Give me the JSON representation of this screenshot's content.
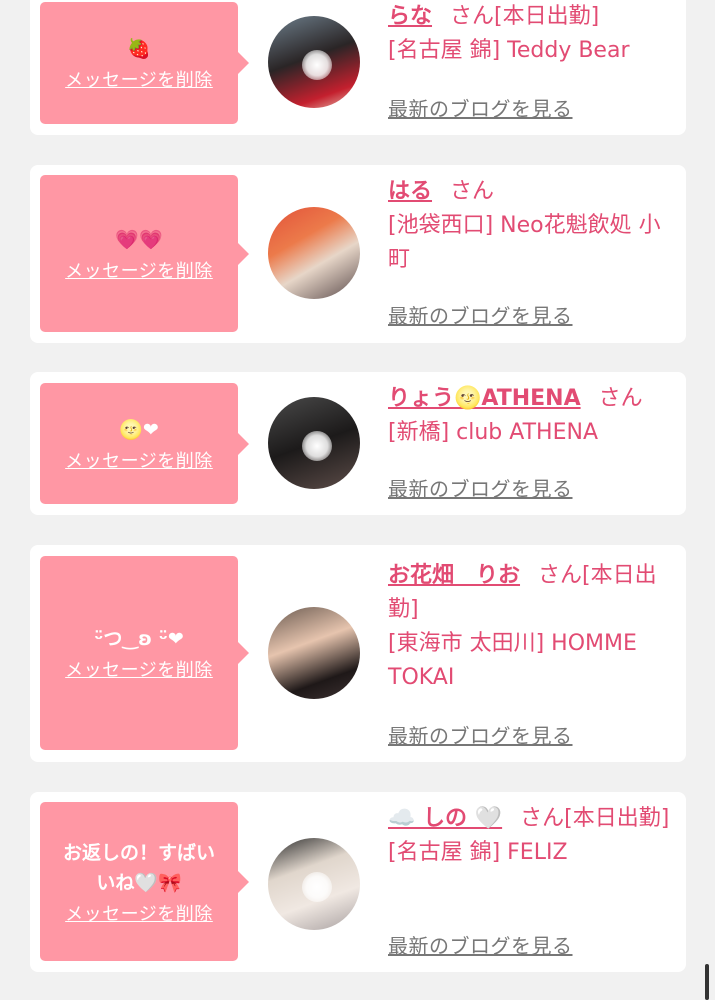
{
  "delete_label": "メッセージを削除",
  "blog_label": "最新のブログを見る",
  "honorific": "さん",
  "colors": {
    "bubble": "#ff97a4",
    "name": "#e24b73",
    "background": "#f1f1f1"
  },
  "items": [
    {
      "message": "🍓",
      "name": "らな",
      "suffix": "[本日出勤]",
      "shop": "[名古屋 錦] Teddy Bear"
    },
    {
      "message": "💗💗",
      "name": "はる",
      "suffix": "",
      "shop": "[池袋西口] Neo花魁飲処 小町"
    },
    {
      "message": "🌝❤",
      "name": "りょう🌝ATHENA",
      "suffix": "",
      "shop": "[新橋] club ATHENA"
    },
    {
      "message": "ᵕ̈つ‿ʚ ᵕ̈❤",
      "name": "お花畑　りお",
      "suffix": "[本日出勤]",
      "shop": "[東海市 太田川] HOMME TOKAI"
    },
    {
      "message": "お返しの！すばい\nいね🤍🎀",
      "name": "☁️ しの 🤍",
      "suffix": "[本日出勤]",
      "shop": "[名古屋 錦] FELIZ"
    }
  ]
}
